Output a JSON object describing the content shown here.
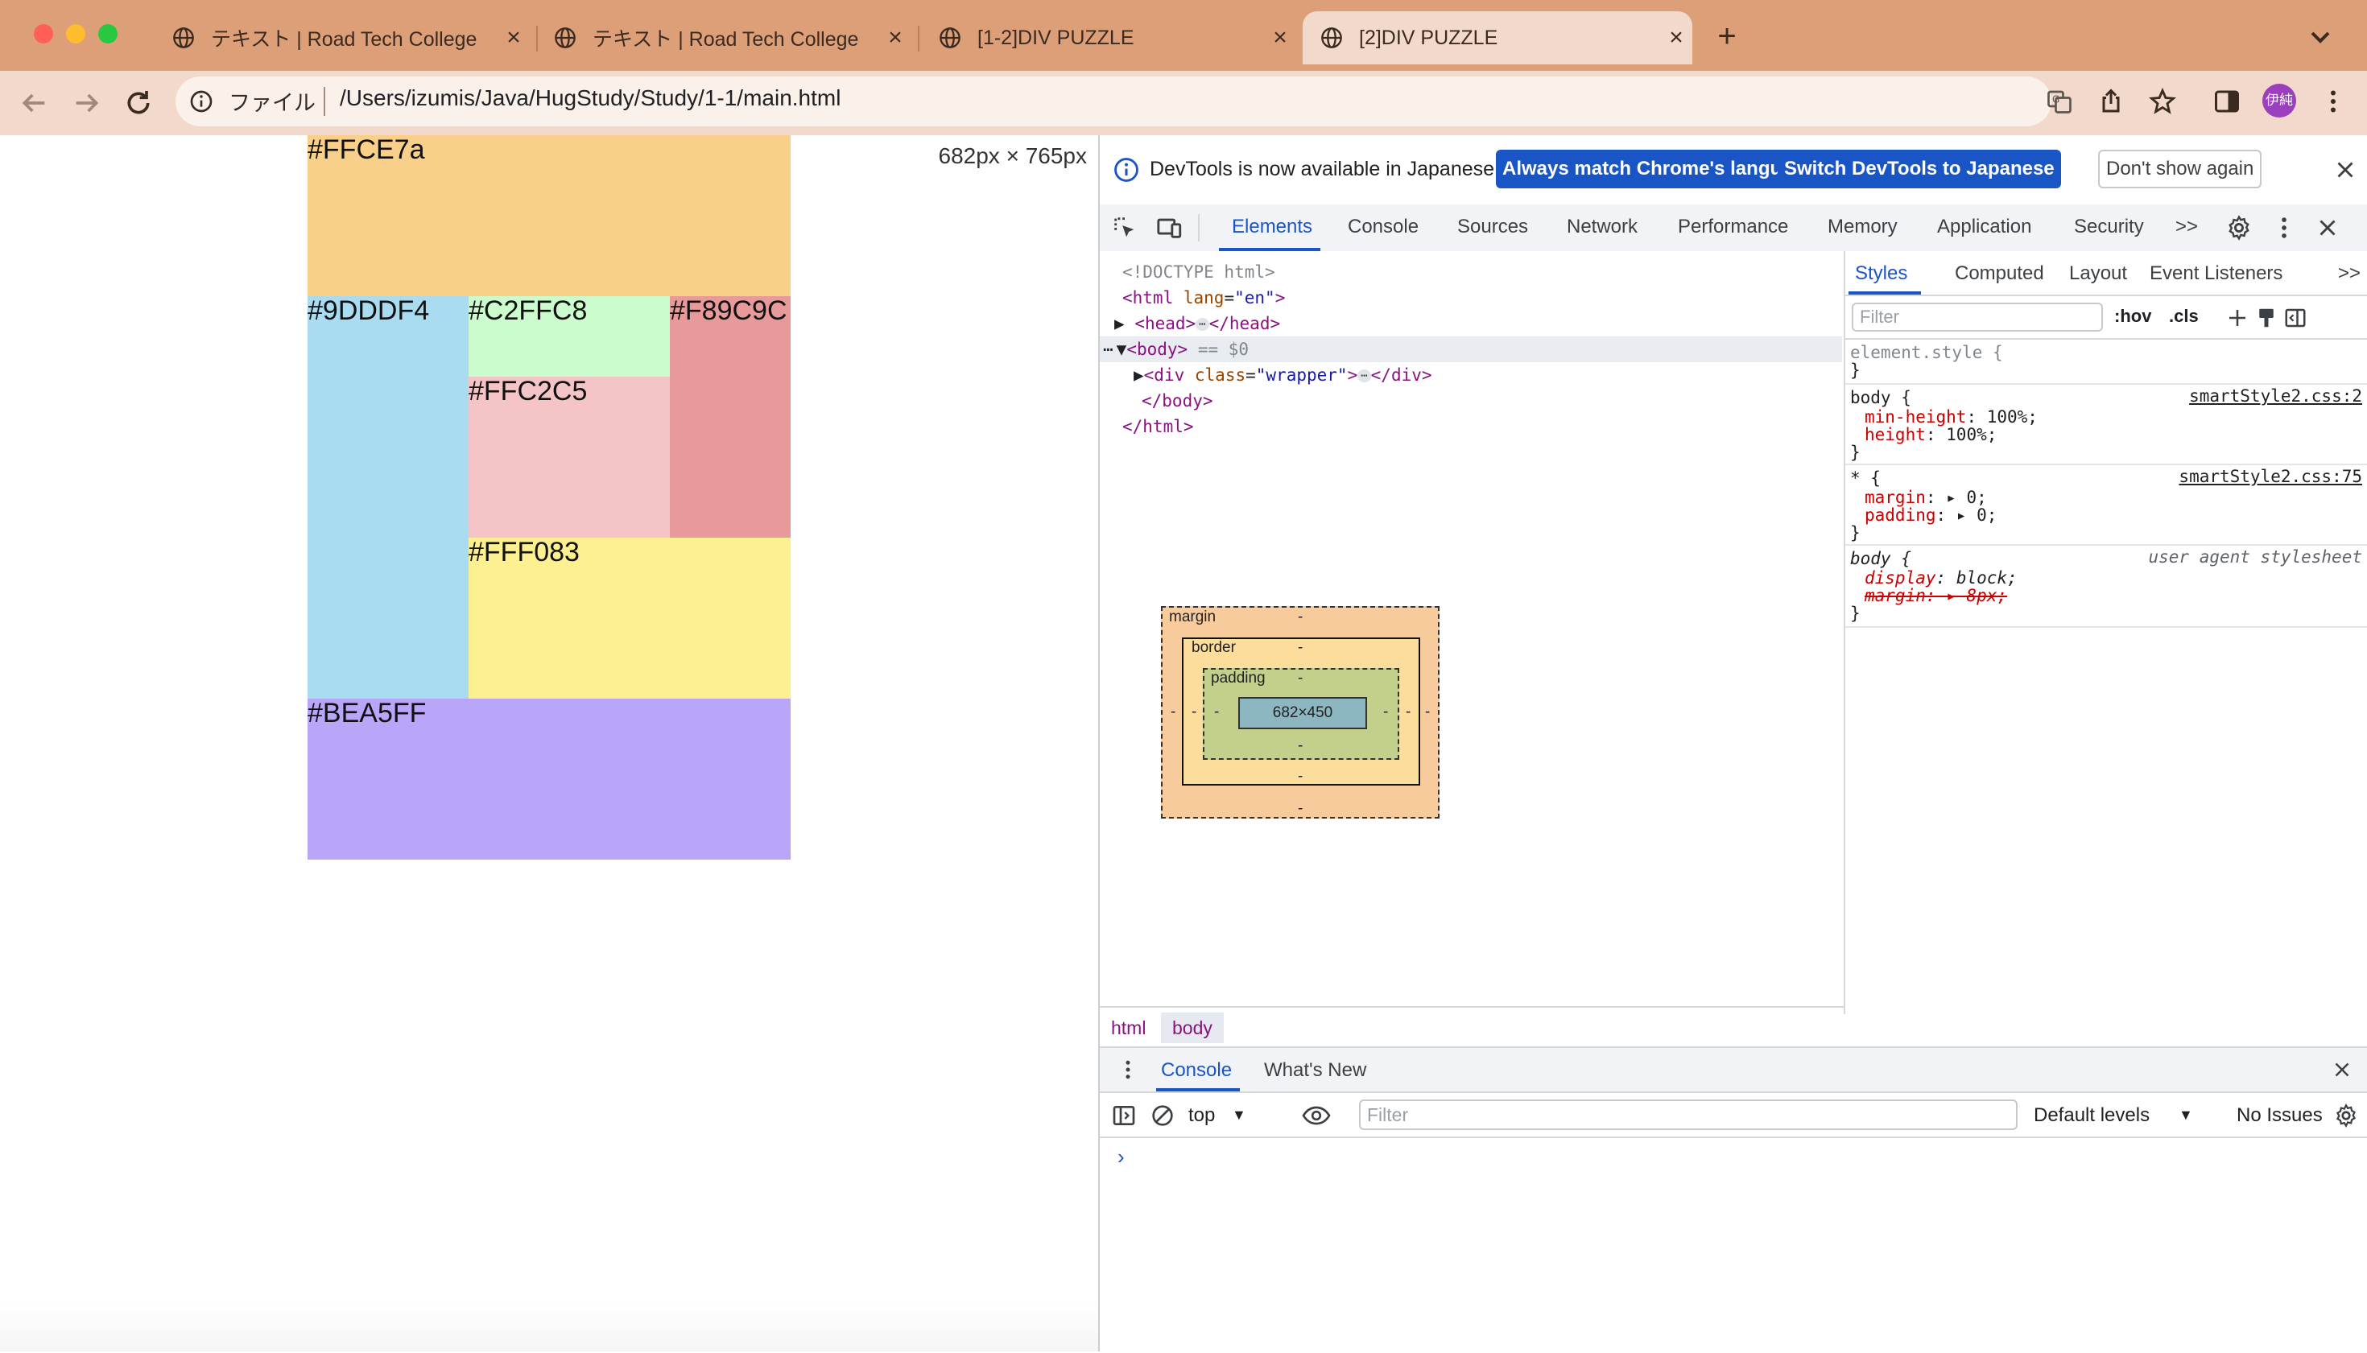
{
  "browser": {
    "tabs": [
      {
        "title": "テキスト | Road Tech College",
        "active": false
      },
      {
        "title": "テキスト | Road Tech College",
        "active": false
      },
      {
        "title": "[1-2]DIV PUZZLE",
        "active": false
      },
      {
        "title": "[2]DIV PUZZLE",
        "active": true
      }
    ],
    "new_tab": "+",
    "address": {
      "scheme_label": "ファイル",
      "url": "/Users/izumis/Java/HugStudy/Study/1-1/main.html"
    },
    "profile_initials": "伊純"
  },
  "page": {
    "size_label": "682px × 765px",
    "blocks": [
      {
        "label": "#FFCE7a",
        "color": "#f8d08a"
      },
      {
        "label": "#9DDDF4",
        "color": "#a9dbf1"
      },
      {
        "label": "#C2FFC8",
        "color": "#ccfccd"
      },
      {
        "label": "#F89C9C",
        "color": "#e89a9a"
      },
      {
        "label": "#FFC2C5",
        "color": "#f4c4c6"
      },
      {
        "label": "#FFF083",
        "color": "#fcf091"
      },
      {
        "label": "#BEA5FF",
        "color": "#b9a6f9"
      }
    ]
  },
  "devtools": {
    "infobar": {
      "message": "DevTools is now available in Japanese!",
      "btn_match": "Always match Chrome's language",
      "btn_switch": "Switch DevTools to Japanese",
      "btn_dismiss": "Don't show again"
    },
    "main_tabs": [
      "Elements",
      "Console",
      "Sources",
      "Network",
      "Performance",
      "Memory",
      "Application",
      "Security"
    ],
    "more_tabs": ">>",
    "dom": {
      "doctype": "<!DOCTYPE html>",
      "html_open": "<html",
      "lang_attr": "lang",
      "lang_val": "\"en\"",
      "gt": ">",
      "head_open": "<head>",
      "head_close": "</head>",
      "body_open": "<body>",
      "selected_marker": "== $0",
      "div_open": "<div",
      "class_attr": "class",
      "class_val": "\"wrapper\"",
      "div_close": "</div>",
      "body_close": "</body>",
      "html_close": "</html>",
      "ellipsis": "⋯",
      "row_dots": "⋯"
    },
    "breadcrumb": [
      "html",
      "body"
    ],
    "styles": {
      "subtabs": [
        "Styles",
        "Computed",
        "Layout",
        "Event Listeners"
      ],
      "more": ">>",
      "filter_placeholder": "Filter",
      "hov": ":hov",
      "cls": ".cls",
      "rules": {
        "element_style": "element.style {",
        "close": "}",
        "body1_selector": "body {",
        "body1_source": "smartStyle2.css:2",
        "body1_props": [
          {
            "name": "min-height",
            "value": "100%;"
          },
          {
            "name": "height",
            "value": "100%;"
          }
        ],
        "star_selector": "* {",
        "star_source": "smartStyle2.css:75",
        "star_props": [
          {
            "name": "margin",
            "value": "0;"
          },
          {
            "name": "padding",
            "value": "0;"
          }
        ],
        "ua_selector": "body {",
        "ua_source": "user agent stylesheet",
        "ua_display_name": "display",
        "ua_display_value": "block;",
        "ua_margin": "margin: ▸ 8px;"
      }
    },
    "box_model": {
      "margin_label": "margin",
      "border_label": "border",
      "padding_label": "padding",
      "content": "682×450",
      "dash": "-"
    },
    "console": {
      "tabs": [
        "Console",
        "What's New"
      ],
      "context": "top",
      "filter_placeholder": "Filter",
      "levels": "Default levels",
      "issues": "No Issues",
      "prompt": "›"
    }
  }
}
